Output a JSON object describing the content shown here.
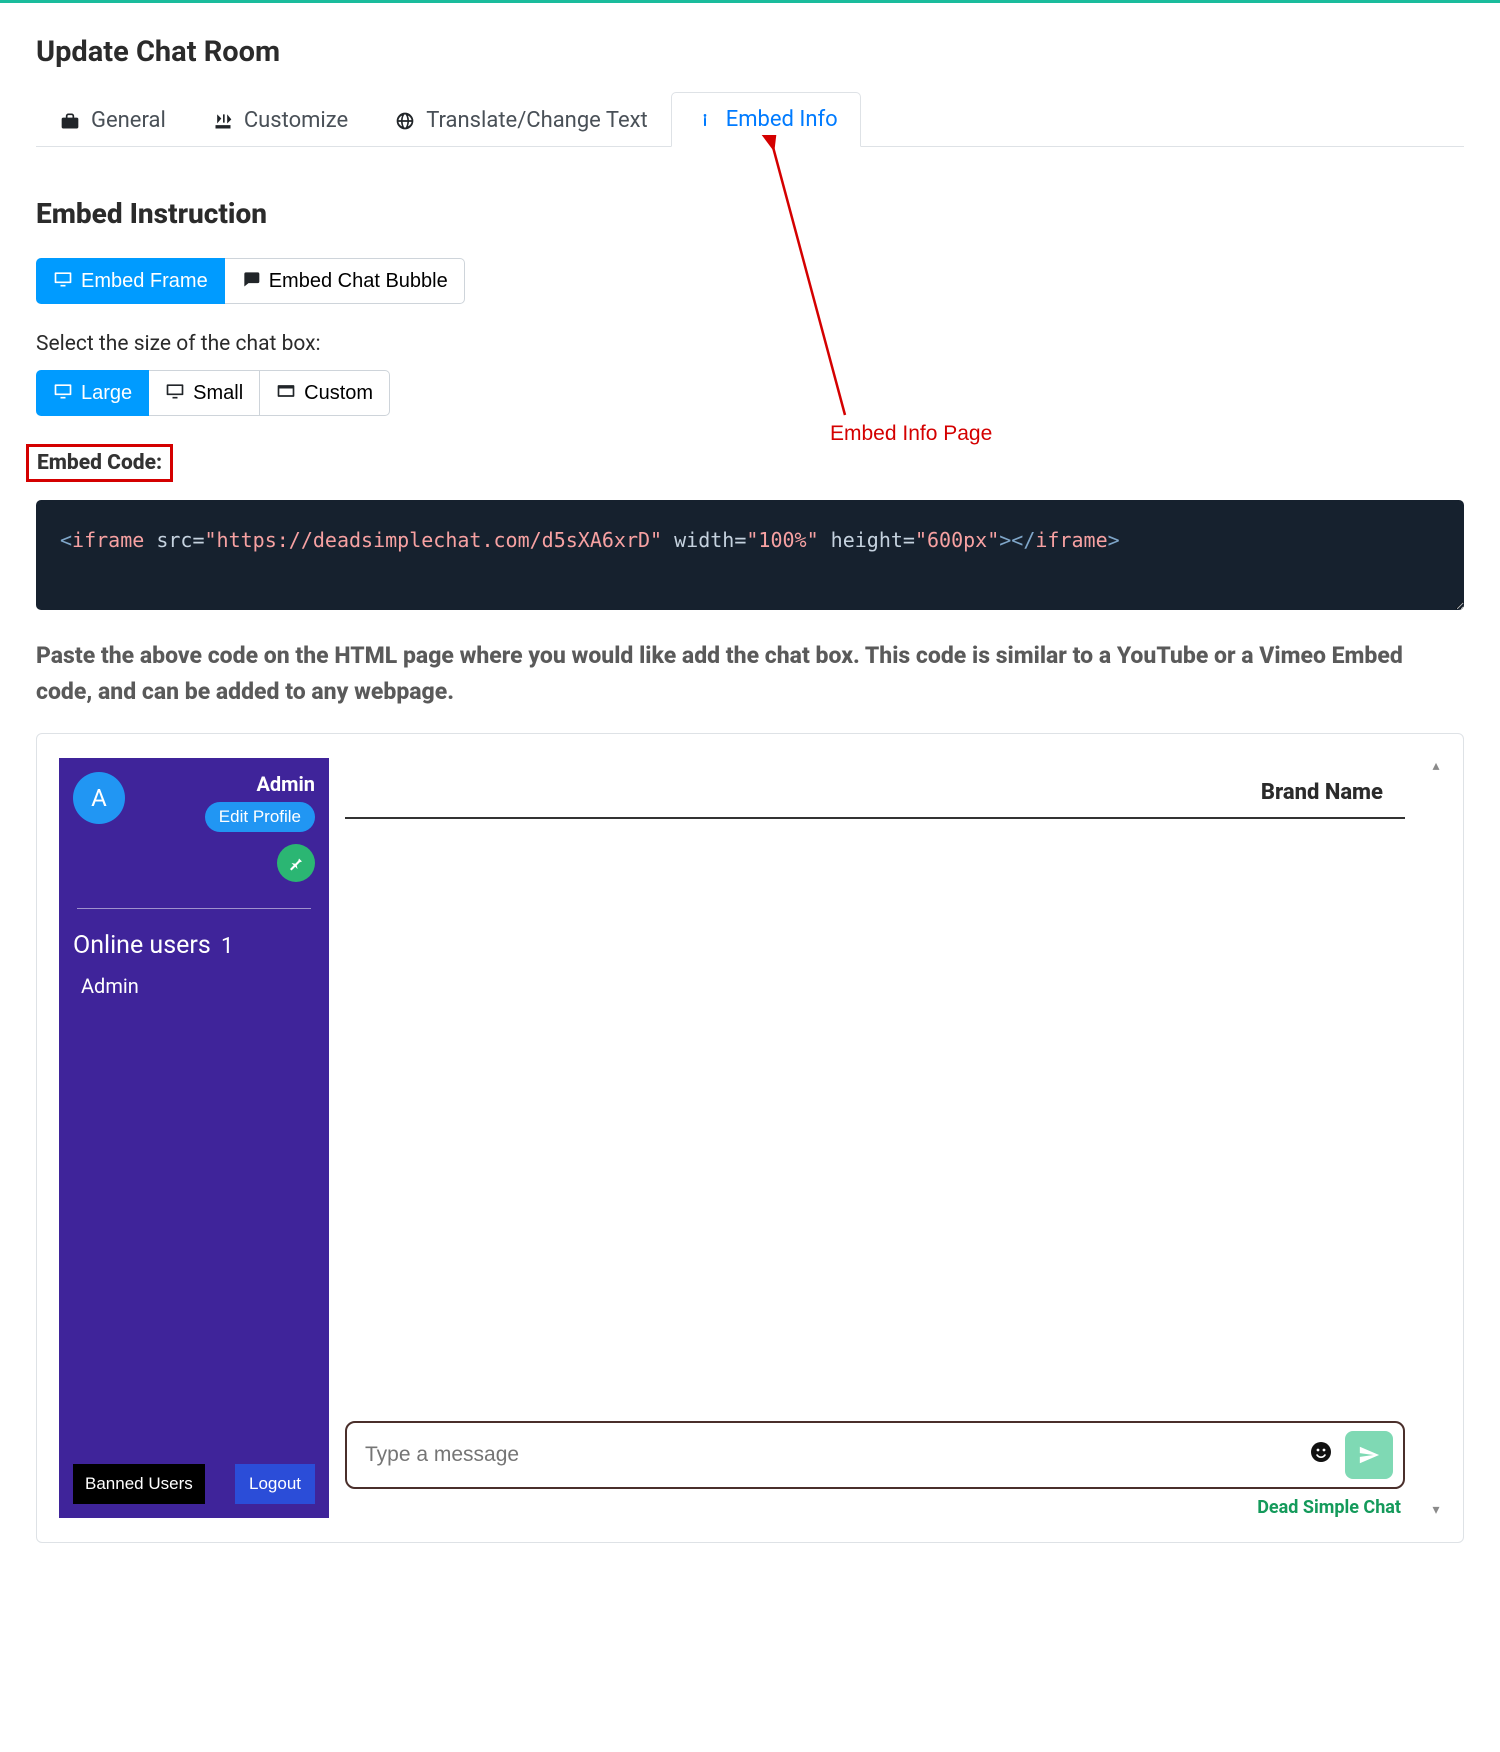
{
  "page": {
    "title": "Update Chat Room"
  },
  "tabs": {
    "general": "General",
    "customize": "Customize",
    "translate": "Translate/Change Text",
    "embed": "Embed Info"
  },
  "annotation": {
    "label": "Embed Info Page"
  },
  "section": {
    "heading": "Embed Instruction",
    "embed_type": {
      "frame": "Embed Frame",
      "bubble": "Embed Chat Bubble"
    },
    "size_label": "Select the size of the chat box:",
    "sizes": {
      "large": "Large",
      "small": "Small",
      "custom": "Custom"
    },
    "code_label": "Embed Code:",
    "code": {
      "open_lt": "<",
      "tag": "iframe",
      "attr_src": " src=",
      "src_val": "\"https://deadsimplechat.com/d5sXA6xrD\"",
      "attr_w": " width=",
      "w_val": "\"100%\"",
      "attr_h": " height=",
      "h_val": "\"600px\"",
      "gt": ">",
      "close": "</",
      "close_gt": ">"
    },
    "paste_desc": "Paste the above code on the HTML page where you would like add the chat box. This code is similar to a YouTube or a Vimeo Embed code, and can be added to any webpage."
  },
  "chat": {
    "avatar_initial": "A",
    "admin": "Admin",
    "edit_profile": "Edit Profile",
    "online_label": "Online users",
    "online_count": "1",
    "users": [
      "Admin"
    ],
    "banned": "Banned Users",
    "logout": "Logout",
    "brand": "Brand Name",
    "input_placeholder": "Type a message",
    "footer_link": "Dead Simple Chat"
  }
}
